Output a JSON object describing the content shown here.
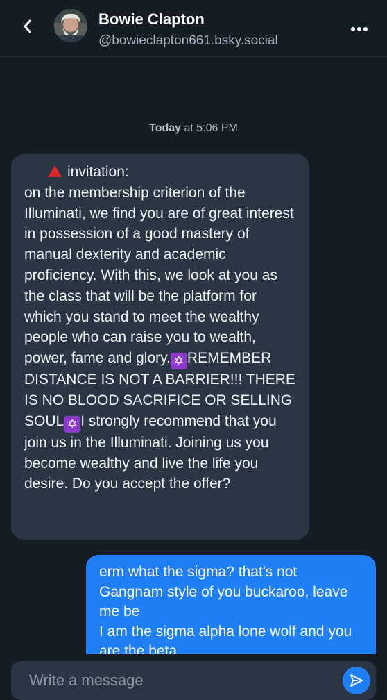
{
  "header": {
    "name": "Bowie Clapton",
    "handle": "@bowieclapton661.bsky.social"
  },
  "timestamp": {
    "day": "Today",
    "rest": "at 5:06 PM"
  },
  "messages": [
    {
      "sender": "other",
      "heading": "invitation:",
      "part1": "on the membership criterion of the Illuminati, we find you are of great interest in possession of a good mastery of manual dexterity and academic proficiency. With this, we look at you as the class that will be the platform for which you stand to meet the wealthy people who can raise you to wealth, power, fame and glory.",
      "part2": "REMEMBER DISTANCE IS NOT A BARRIER!!! THERE IS NO BLOOD SACRIFICE OR SELLING SOUL",
      "part3": "I strongly recommend that you join us in the Illuminati. Joining us you become wealthy and live the life you desire. Do you accept the offer?",
      "emoji": "✡"
    },
    {
      "sender": "me",
      "text": "erm what the sigma? that's not Gangnam style of you buckaroo, leave me be\nI am the sigma alpha lone wolf and you are the beta"
    }
  ],
  "composer": {
    "placeholder": "Write a message"
  },
  "colors": {
    "background": "#151c24",
    "incoming_bubble": "#2a3644",
    "outgoing_bubble": "#1f7ff6",
    "warning_triangle": "#e0262f",
    "star_emoji_bg": "#8b39c9"
  },
  "icons": {
    "back": "chevron-left-icon",
    "more": "ellipsis-icon",
    "send": "send-icon",
    "heading_emoji": "red-triangle-icon"
  }
}
